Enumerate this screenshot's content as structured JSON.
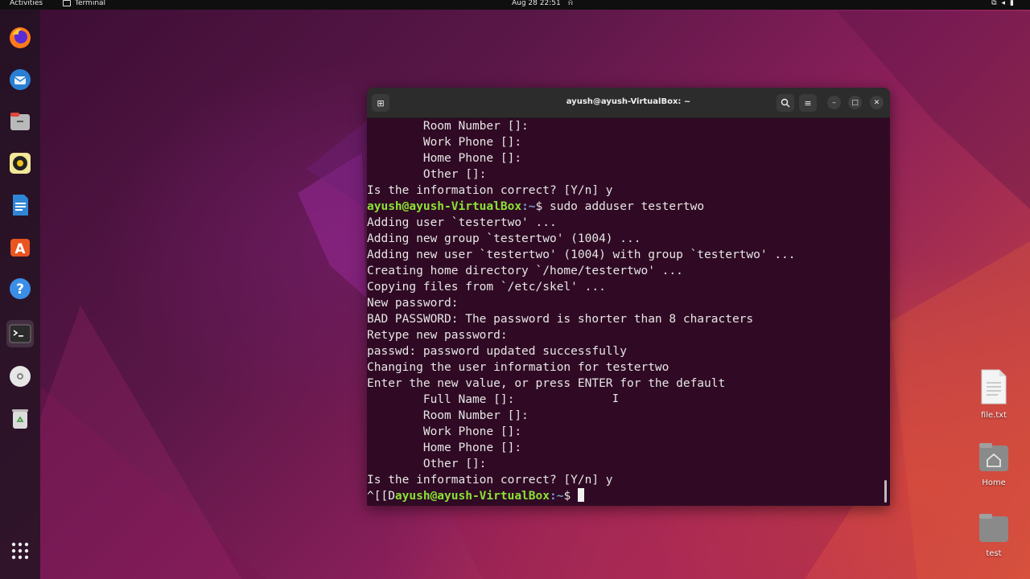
{
  "topbar": {
    "activities": "Activities",
    "app_name": "Terminal",
    "clock": "Aug 28  22:51"
  },
  "dock": {
    "items": [
      {
        "name": "firefox-icon",
        "active": false
      },
      {
        "name": "thunderbird-icon",
        "active": false
      },
      {
        "name": "files-icon",
        "active": false
      },
      {
        "name": "rhythmbox-icon",
        "active": false
      },
      {
        "name": "writer-icon",
        "active": false
      },
      {
        "name": "software-icon",
        "active": false
      },
      {
        "name": "help-icon",
        "active": false
      },
      {
        "name": "terminal-icon",
        "active": true
      },
      {
        "name": "disc-icon",
        "active": false
      },
      {
        "name": "trash-icon",
        "active": false
      }
    ],
    "apps_grid_icon": "apps-grid-icon"
  },
  "terminal": {
    "title": "ayush@ayush-VirtualBox: ~",
    "lines": [
      {
        "pre": "        Room Number []:"
      },
      {
        "pre": "        Work Phone []:"
      },
      {
        "pre": "        Home Phone []:"
      },
      {
        "pre": "        Other []:"
      },
      {
        "pre": "Is the information correct? [Y/n] y"
      },
      {
        "user": "ayush@ayush-VirtualBox",
        "path": ":~",
        "post": "$ sudo adduser testertwo"
      },
      {
        "pre": "Adding user `testertwo' ..."
      },
      {
        "pre": "Adding new group `testertwo' (1004) ..."
      },
      {
        "pre": "Adding new user `testertwo' (1004) with group `testertwo' ..."
      },
      {
        "pre": "Creating home directory `/home/testertwo' ..."
      },
      {
        "pre": "Copying files from `/etc/skel' ..."
      },
      {
        "pre": "New password:"
      },
      {
        "pre": "BAD PASSWORD: The password is shorter than 8 characters"
      },
      {
        "pre": "Retype new password:"
      },
      {
        "pre": "passwd: password updated successfully"
      },
      {
        "pre": "Changing the user information for testertwo"
      },
      {
        "pre": "Enter the new value, or press ENTER for the default"
      },
      {
        "pre": "        Full Name []:"
      },
      {
        "pre": "        Room Number []:"
      },
      {
        "pre": "        Work Phone []:"
      },
      {
        "pre": "        Home Phone []:"
      },
      {
        "pre": "        Other []:"
      },
      {
        "pre": "Is the information correct? [Y/n] y"
      },
      {
        "pre": "^[[D",
        "user": "ayush@ayush-VirtualBox",
        "path": ":~",
        "post": "$ ",
        "cursor": true
      }
    ]
  },
  "desktop": {
    "icons": [
      {
        "label": "file.txt",
        "icon": "text-file-icon"
      },
      {
        "label": "Home",
        "icon": "home-folder-icon"
      },
      {
        "label": "test",
        "icon": "folder-icon"
      }
    ]
  },
  "colors": {
    "terminal_bg": "#300a24",
    "prompt_user": "#8ae234",
    "prompt_path": "#729fcf",
    "titlebar": "#2c2c2c"
  }
}
